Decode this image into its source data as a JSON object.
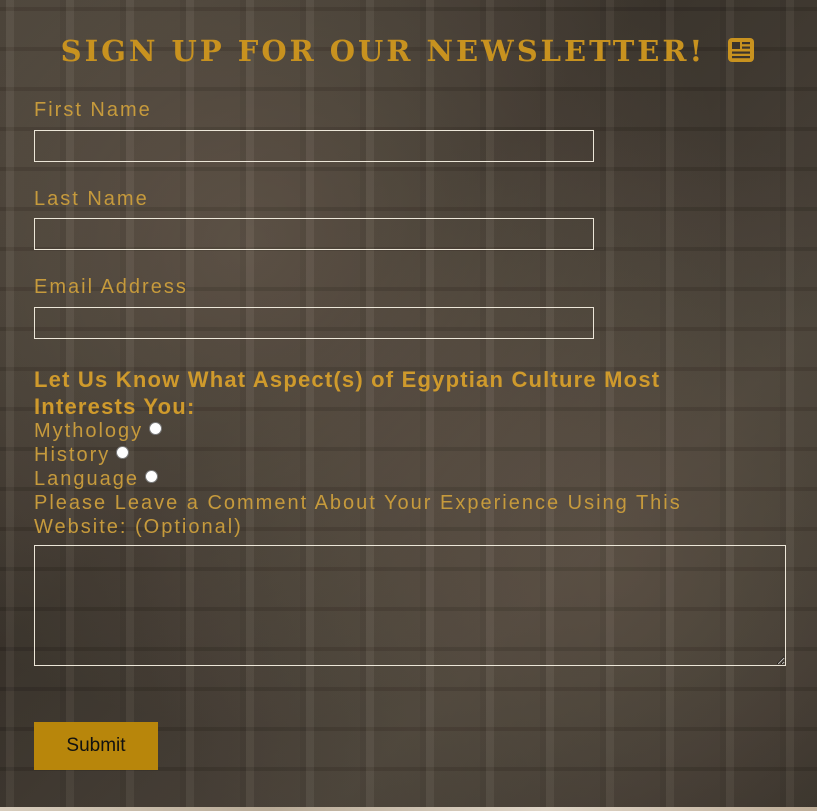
{
  "newsletter": {
    "title": "SIGN UP FOR OUR NEWSLETTER!",
    "title_icon": "newspaper-icon"
  },
  "fields": {
    "first_name_label": "First Name",
    "first_name_value": "",
    "last_name_label": "Last Name",
    "last_name_value": "",
    "email_label": "Email Address",
    "email_value": ""
  },
  "interests": {
    "question": "Let Us Know What Aspect(s) of Egyptian Culture Most Interests You:",
    "options": [
      {
        "label": "Mythology",
        "checked": false
      },
      {
        "label": "History",
        "checked": false
      },
      {
        "label": "Language",
        "checked": false
      }
    ]
  },
  "comment": {
    "label": "Please Leave a Comment About Your Experience Using This Website: (Optional)",
    "value": ""
  },
  "submit": {
    "label": "Submit"
  },
  "colors": {
    "accent": "#c8921f",
    "button": "#b8860b",
    "field_border": "#ece6d8"
  }
}
